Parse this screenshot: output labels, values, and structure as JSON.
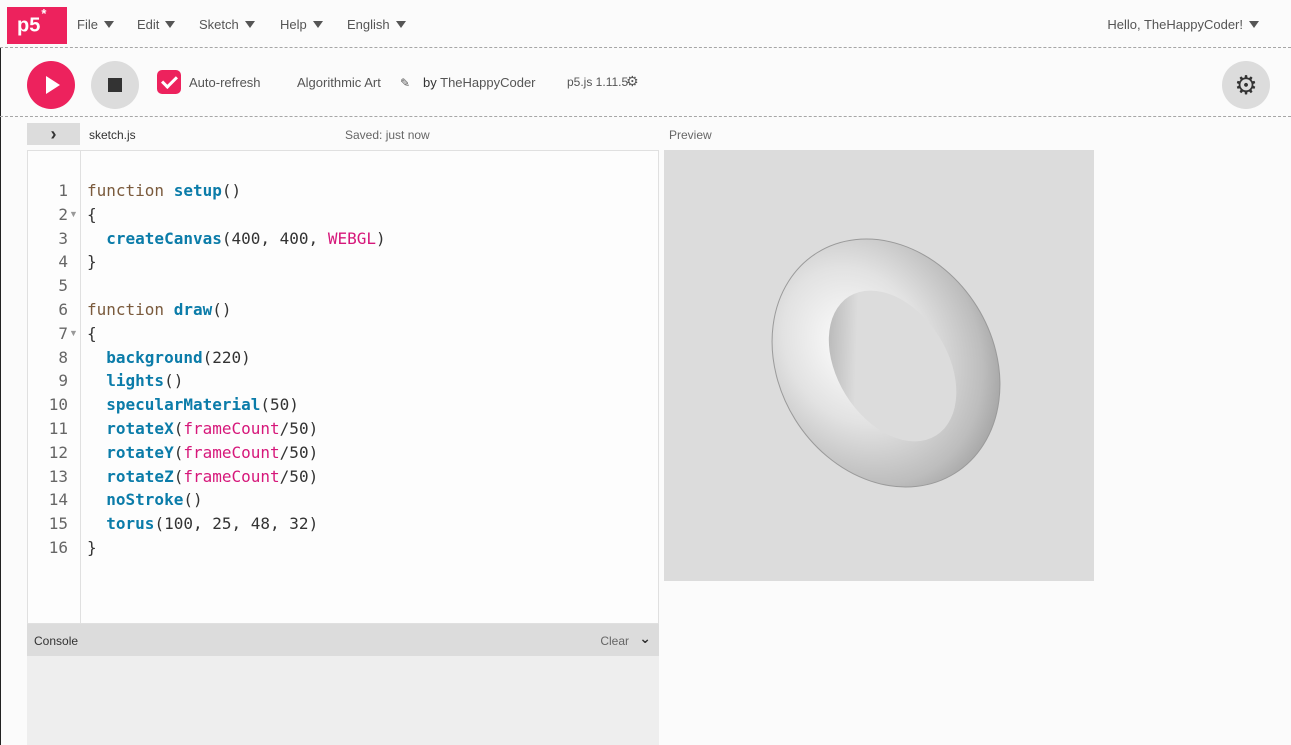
{
  "nav": {
    "logo": "p5",
    "logo_star": "*",
    "menus": [
      {
        "label": "File"
      },
      {
        "label": "Edit"
      },
      {
        "label": "Sketch"
      },
      {
        "label": "Help"
      },
      {
        "label": "English"
      }
    ],
    "greeting": "Hello, TheHappyCoder!"
  },
  "toolbar": {
    "play_icon": "play-icon",
    "stop_icon": "stop-icon",
    "autorefresh_label": "Auto-refresh",
    "autorefresh_checked": true,
    "sketch_name": "Algorithmic Art",
    "by_label": "by",
    "owner": "TheHappyCoder",
    "version": "p5.js 1.11.5",
    "settings_icon": "gear-icon"
  },
  "editor": {
    "filename": "sketch.js",
    "status": "Saved: just now",
    "lines": [
      "function setup()",
      "{",
      "  createCanvas(400, 400, WEBGL)",
      "}",
      "",
      "function draw()",
      "{",
      "  background(220)",
      "  lights()",
      "  specularMaterial(50)",
      "  rotateX(frameCount/50)",
      "  rotateY(frameCount/50)",
      "  rotateZ(frameCount/50)",
      "  noStroke()",
      "  torus(100, 25, 48, 32)",
      "}"
    ]
  },
  "console": {
    "title": "Console",
    "clear_label": "Clear"
  },
  "preview": {
    "label": "Preview",
    "background": "#dcdcdc"
  },
  "colors": {
    "accent": "#ed225d",
    "keyword": "#7a5a3c",
    "function": "#0b7ca9",
    "constant": "#d6177a"
  }
}
